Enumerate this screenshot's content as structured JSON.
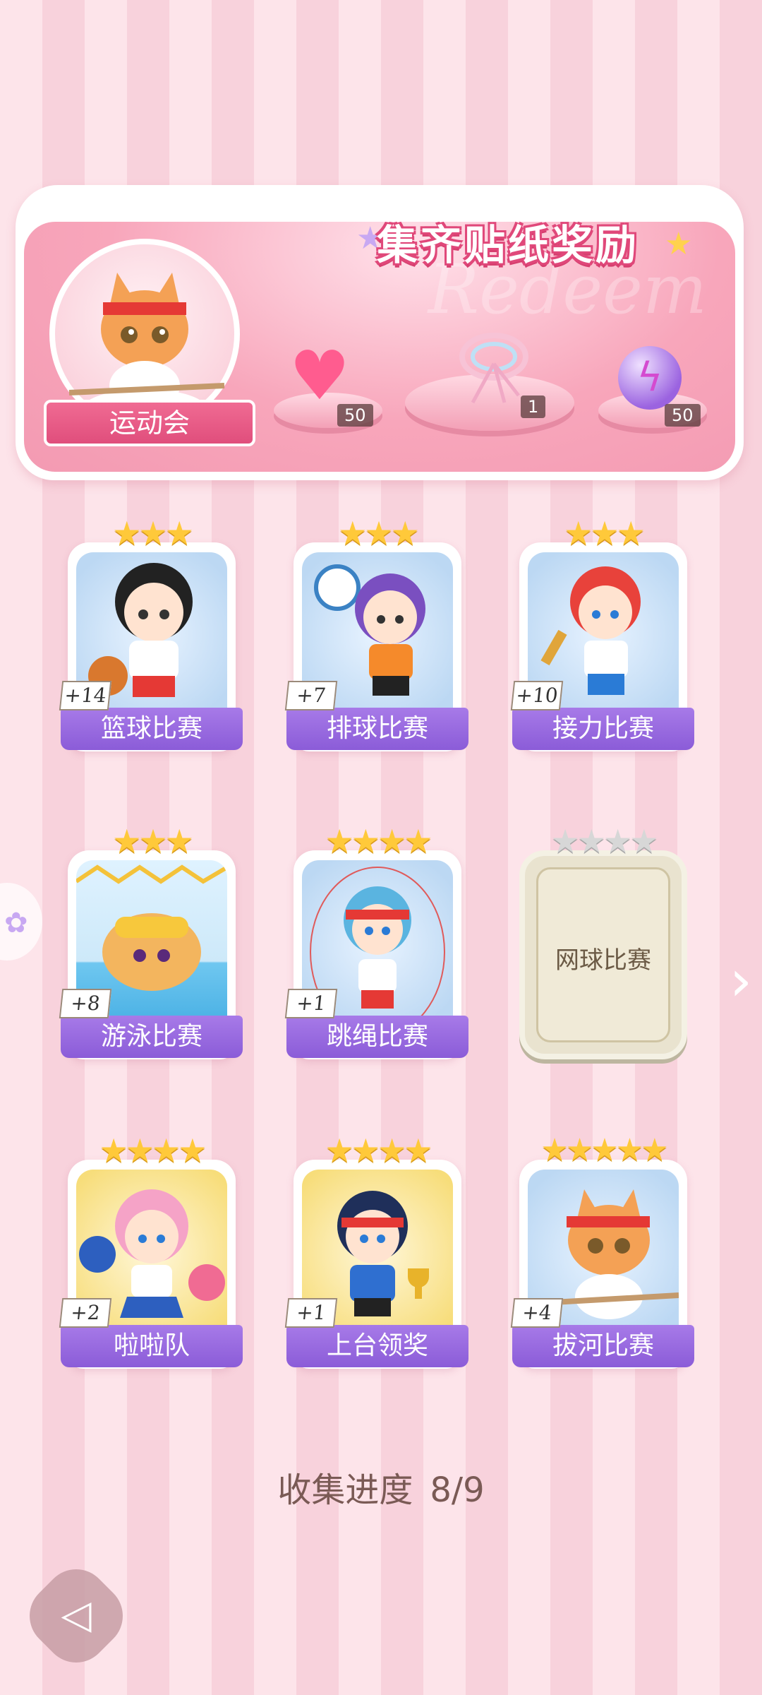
{
  "banner": {
    "title": "集齐贴纸奖励",
    "watermark": "Redeem",
    "event_name": "运动会",
    "rewards": [
      {
        "icon": "pink-heart-gem-icon",
        "qty": "50"
      },
      {
        "icon": "ribbon-bow-icon",
        "qty": "1"
      },
      {
        "icon": "purple-lightning-orb-icon",
        "qty": "50"
      }
    ]
  },
  "cards": [
    {
      "name": "篮球比赛",
      "count": "+14",
      "stars_earned": 3,
      "stars_total": 3,
      "state": "collected"
    },
    {
      "name": "排球比赛",
      "count": "+7",
      "stars_earned": 3,
      "stars_total": 3,
      "state": "collected"
    },
    {
      "name": "接力比赛",
      "count": "+10",
      "stars_earned": 3,
      "stars_total": 3,
      "state": "collected"
    },
    {
      "name": "游泳比赛",
      "count": "+8",
      "stars_earned": 3,
      "stars_total": 3,
      "state": "collected"
    },
    {
      "name": "跳绳比赛",
      "count": "+1",
      "stars_earned": 4,
      "stars_total": 4,
      "state": "collected"
    },
    {
      "name": "网球比赛",
      "count": "",
      "stars_earned": 0,
      "stars_total": 4,
      "state": "locked"
    },
    {
      "name": "啦啦队",
      "count": "+2",
      "stars_earned": 4,
      "stars_total": 4,
      "state": "collected"
    },
    {
      "name": "上台领奖",
      "count": "+1",
      "stars_earned": 4,
      "stars_total": 4,
      "state": "collected"
    },
    {
      "name": "拔河比赛",
      "count": "+4",
      "stars_earned": 5,
      "stars_total": 5,
      "state": "collected"
    }
  ],
  "progress": {
    "label": "收集进度",
    "value": "8/9"
  },
  "nav": {
    "next_icon": "chevron-right-icon",
    "back_icon": "back-arrow-icon"
  },
  "colors": {
    "label_purple": "#8b5cd8",
    "banner_pink": "#f39ab2",
    "star_gold": "#ffc93a"
  }
}
